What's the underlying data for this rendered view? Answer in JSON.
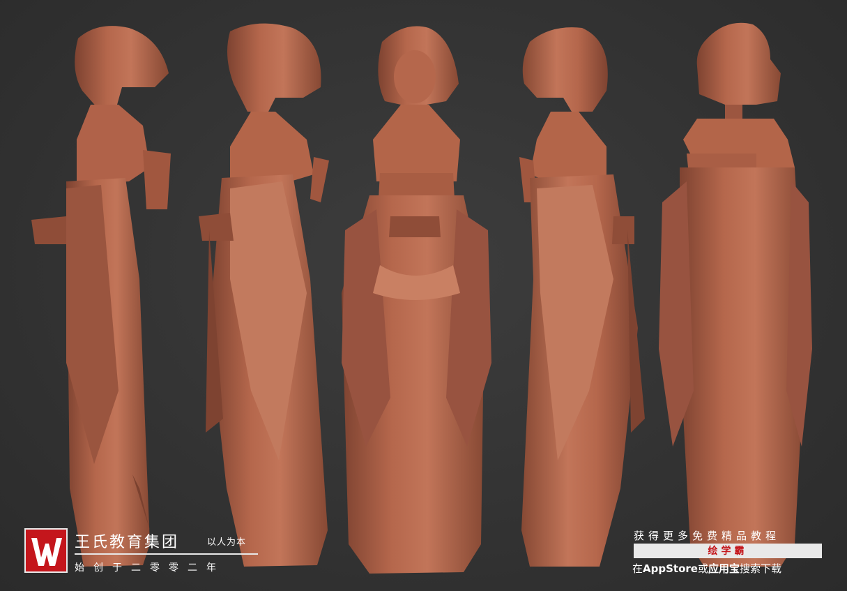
{
  "scene": {
    "background_color": "#363636",
    "clay_color": "#b5674c",
    "clay_shadow": "#7e4331",
    "clay_highlight": "#cf8a6e",
    "views": [
      "side-left",
      "three-quarter-left",
      "front",
      "three-quarter-right",
      "back"
    ]
  },
  "brand": {
    "logo_letter": "W",
    "name": "王氏教育集团",
    "slogan": "以人为本",
    "since": "始创于二零零二年",
    "logo_color": "#c4161c"
  },
  "promo": {
    "line1": "获得更多免费精品教程",
    "app_name": "绘学霸",
    "line3_prefix": "在",
    "store1": "AppStore",
    "line3_or": "或",
    "store2": "应用宝",
    "line3_suffix": "搜索下载"
  }
}
